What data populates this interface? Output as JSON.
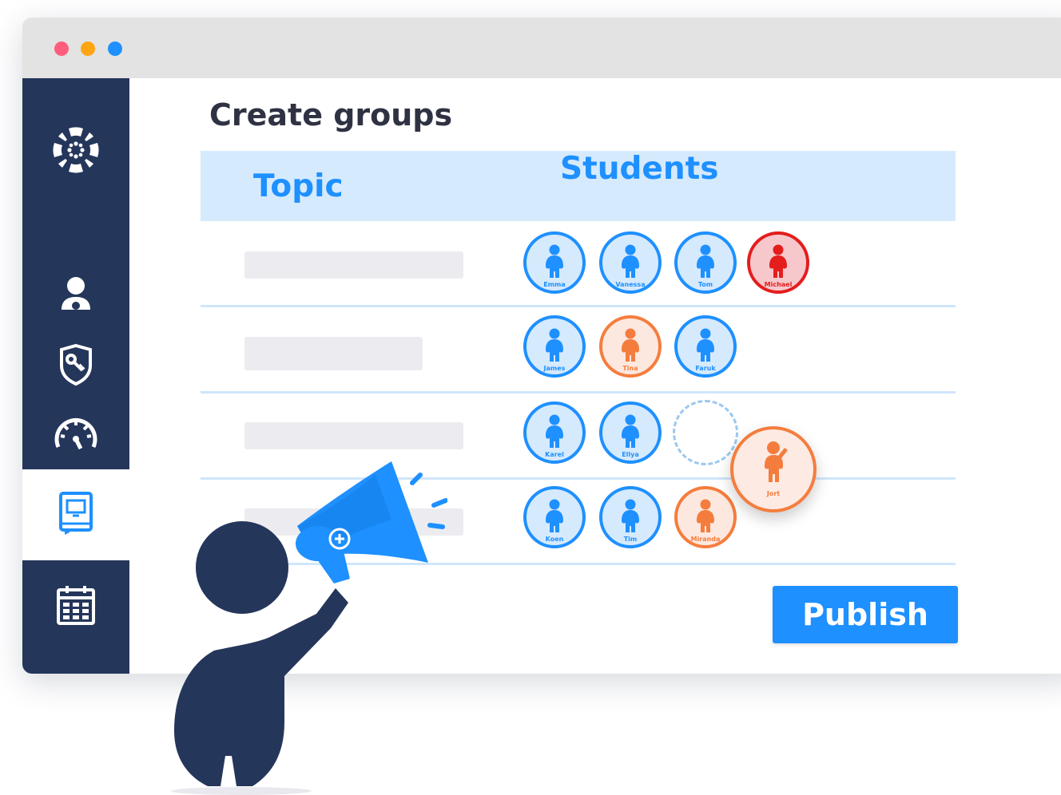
{
  "page": {
    "title": "Create groups",
    "publish_label": "Publish"
  },
  "table": {
    "headers": {
      "topic": "Topic",
      "students": "Students"
    },
    "rows": [
      {
        "students": [
          {
            "name": "Emma",
            "color": "blue"
          },
          {
            "name": "Vanessa",
            "color": "blue"
          },
          {
            "name": "Tom",
            "color": "blue"
          },
          {
            "name": "Michael",
            "color": "red"
          }
        ]
      },
      {
        "students": [
          {
            "name": "James",
            "color": "blue"
          },
          {
            "name": "Tina",
            "color": "orange"
          },
          {
            "name": "Faruk",
            "color": "blue"
          }
        ]
      },
      {
        "students": [
          {
            "name": "Karel",
            "color": "blue"
          },
          {
            "name": "Ellya",
            "color": "blue"
          }
        ]
      },
      {
        "students": [
          {
            "name": "Koen",
            "color": "blue"
          },
          {
            "name": "Tim",
            "color": "blue"
          },
          {
            "name": "Miranda",
            "color": "orange"
          }
        ]
      }
    ],
    "dragging_student": {
      "name": "Jort",
      "color": "orange"
    }
  },
  "sidebar": {
    "items": [
      {
        "icon": "canvas-logo-icon"
      },
      {
        "icon": "user-icon"
      },
      {
        "icon": "shield-key-icon"
      },
      {
        "icon": "dashboard-gauge-icon"
      },
      {
        "icon": "course-book-icon",
        "active": true
      },
      {
        "icon": "calendar-icon"
      }
    ]
  },
  "colors": {
    "sidebar": "#25365b",
    "accent": "#1e90ff",
    "orange": "#f47d3e",
    "red": "#e41d1d",
    "header_bg": "#d6eafd"
  }
}
